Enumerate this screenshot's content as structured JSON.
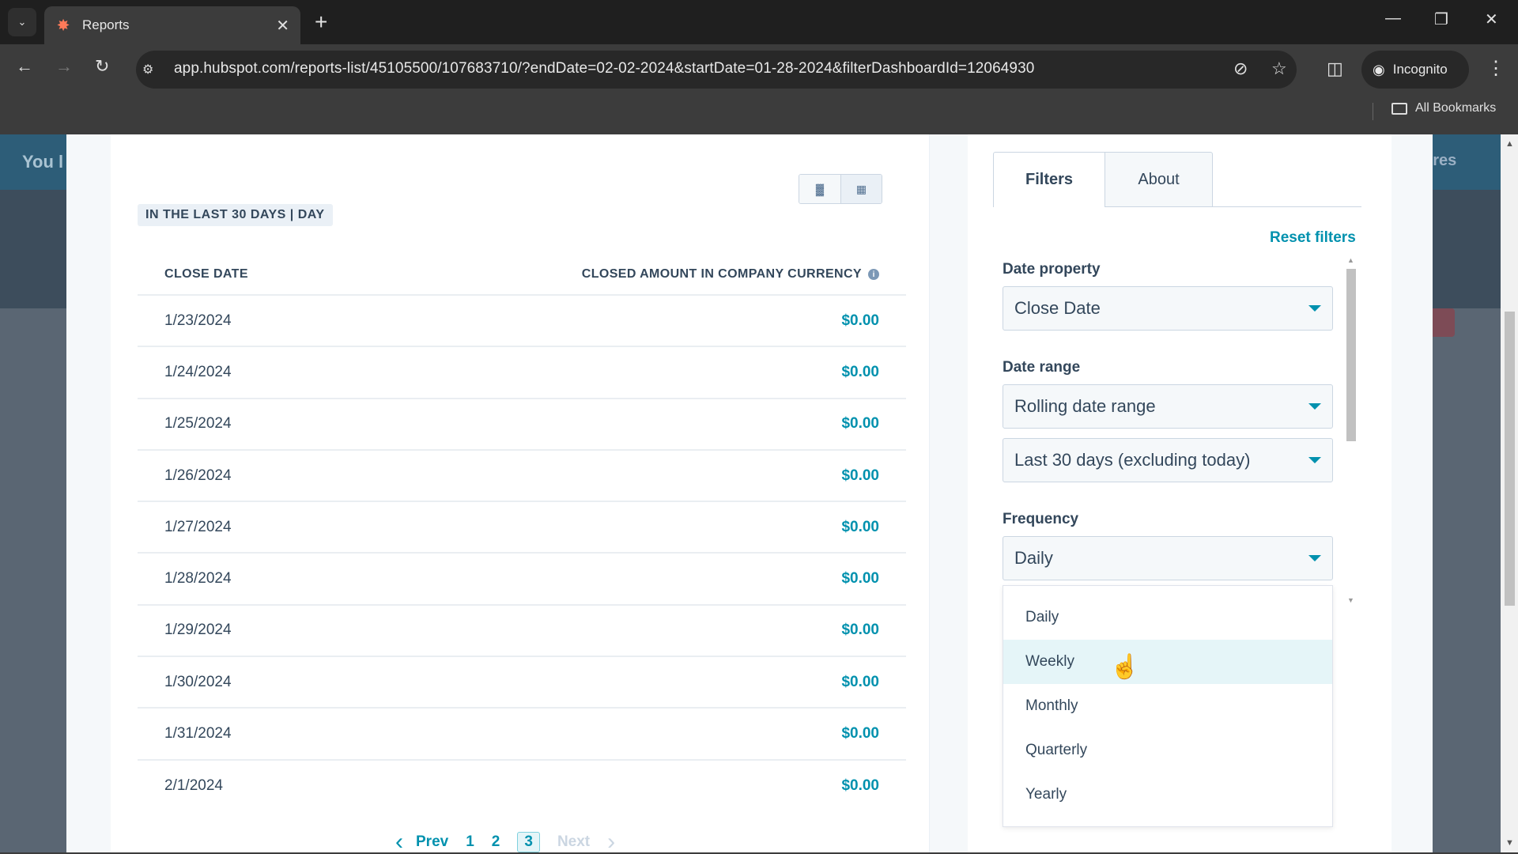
{
  "browser": {
    "tab_title": "Reports",
    "url": "app.hubspot.com/reports-list/45105500/107683710/?endDate=02-02-2024&startDate=01-28-2024&filterDashboardId=12064930",
    "incognito_label": "Incognito",
    "bookmarks_label": "All Bookmarks"
  },
  "background": {
    "header_text": "You l",
    "header_right_text": "ures"
  },
  "report": {
    "period_tag": "IN THE LAST 30 DAYS | DAY",
    "columns": [
      "CLOSE DATE",
      "CLOSED AMOUNT IN COMPANY CURRENCY"
    ],
    "rows": [
      {
        "date": "1/23/2024",
        "amount": "$0.00"
      },
      {
        "date": "1/24/2024",
        "amount": "$0.00"
      },
      {
        "date": "1/25/2024",
        "amount": "$0.00"
      },
      {
        "date": "1/26/2024",
        "amount": "$0.00"
      },
      {
        "date": "1/27/2024",
        "amount": "$0.00"
      },
      {
        "date": "1/28/2024",
        "amount": "$0.00"
      },
      {
        "date": "1/29/2024",
        "amount": "$0.00"
      },
      {
        "date": "1/30/2024",
        "amount": "$0.00"
      },
      {
        "date": "1/31/2024",
        "amount": "$0.00"
      },
      {
        "date": "2/1/2024",
        "amount": "$0.00"
      }
    ],
    "pagination": {
      "prev": "Prev",
      "next": "Next",
      "pages": [
        "1",
        "2",
        "3"
      ],
      "current": "3"
    }
  },
  "panel": {
    "tabs": [
      "Filters",
      "About"
    ],
    "active_tab": "Filters",
    "reset_label": "Reset filters",
    "date_property": {
      "label": "Date property",
      "value": "Close Date"
    },
    "date_range": {
      "label": "Date range",
      "type_value": "Rolling date range",
      "range_value": "Last 30 days (excluding today)"
    },
    "frequency": {
      "label": "Frequency",
      "value": "Daily",
      "options": [
        "Daily",
        "Weekly",
        "Monthly",
        "Quarterly",
        "Yearly"
      ],
      "hovered": "Weekly"
    }
  },
  "colors": {
    "accent": "#0091ae",
    "text": "#33475b",
    "hover": "#e5f5f8",
    "brand": "#ff7a59"
  }
}
